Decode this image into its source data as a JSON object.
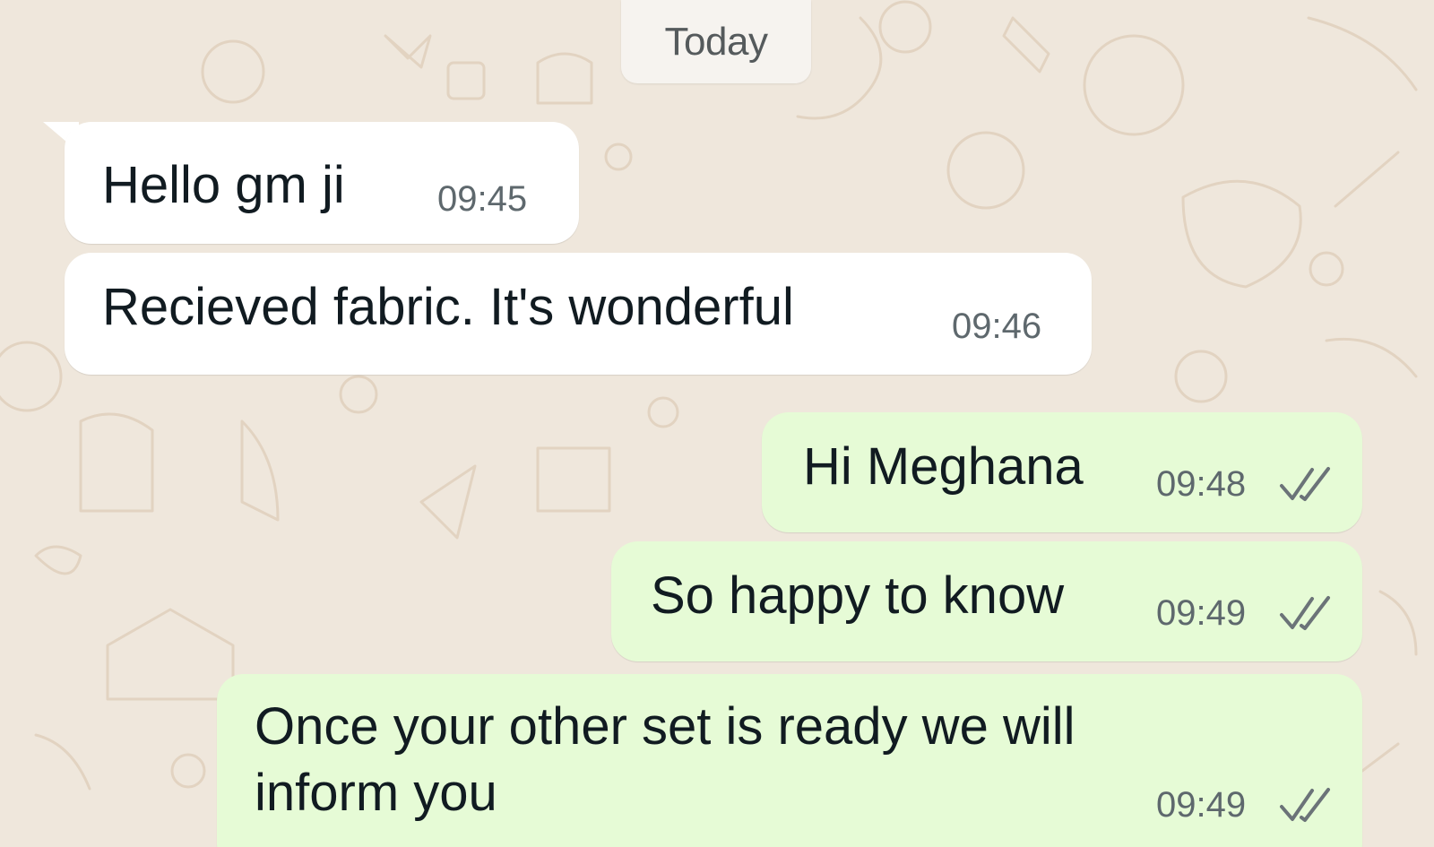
{
  "date_chip": {
    "label": "Today"
  },
  "messages": [
    {
      "direction": "incoming",
      "text": "Hello gm ji",
      "time": "09:45"
    },
    {
      "direction": "incoming",
      "text": "Recieved fabric. It's wonderful",
      "time": "09:46"
    },
    {
      "direction": "outgoing",
      "text": "Hi Meghana",
      "time": "09:48",
      "status_icon": "double-check-icon"
    },
    {
      "direction": "outgoing",
      "text": "So happy to know",
      "time": "09:49",
      "status_icon": "double-check-icon"
    },
    {
      "direction": "outgoing",
      "text_lines": [
        "Once your other set is ready we will",
        "inform you"
      ],
      "time": "09:49",
      "status_icon": "double-check-icon"
    }
  ],
  "colors": {
    "wallpaper": "#efe7dc",
    "incoming_bubble": "#ffffff",
    "outgoing_bubble": "#e6fbd6",
    "tick_color": "#6b7378"
  }
}
